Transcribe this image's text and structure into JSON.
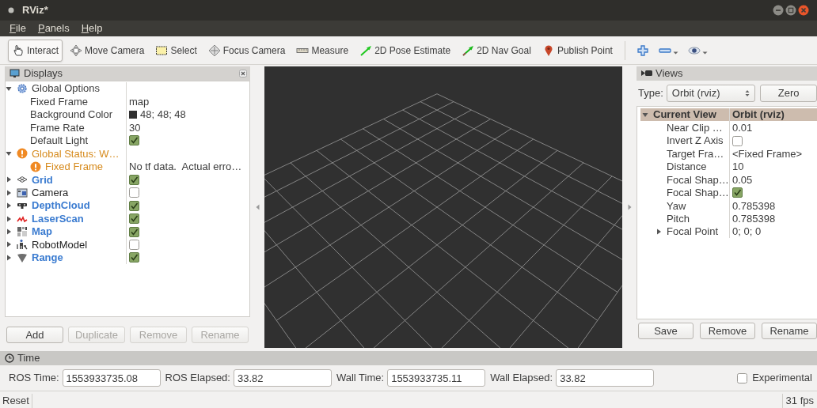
{
  "window": {
    "title": "RViz*"
  },
  "menu": [
    {
      "label": "File"
    },
    {
      "label": "Panels"
    },
    {
      "label": "Help"
    }
  ],
  "toolbar": {
    "tools": [
      {
        "label": "Interact",
        "selected": true
      },
      {
        "label": "Move Camera",
        "selected": false
      },
      {
        "label": "Select",
        "selected": false
      },
      {
        "label": "Focus Camera",
        "selected": false
      },
      {
        "label": "Measure",
        "selected": false
      },
      {
        "label": "2D Pose Estimate",
        "selected": false
      },
      {
        "label": "2D Nav Goal",
        "selected": false
      },
      {
        "label": "Publish Point",
        "selected": false
      }
    ]
  },
  "displays_panel": {
    "title": "Displays",
    "tree": [
      {
        "label": "Global Options",
        "expanded": true,
        "children": [
          {
            "label": "Fixed Frame",
            "value": "map"
          },
          {
            "label": "Background Color",
            "value": "48; 48; 48",
            "color": "#303030"
          },
          {
            "label": "Frame Rate",
            "value": "30"
          },
          {
            "label": "Default Light",
            "checked": true
          }
        ]
      },
      {
        "label": "Global Status: W…",
        "warning": true,
        "expanded": true,
        "children": [
          {
            "label": "Fixed Frame",
            "warning": true,
            "value": "No tf data.  Actual erro…"
          }
        ]
      },
      {
        "label": "Grid",
        "checked": true,
        "expanded": false
      },
      {
        "label": "Camera",
        "checked": false,
        "expanded": false
      },
      {
        "label": "DepthCloud",
        "checked": true,
        "expanded": false
      },
      {
        "label": "LaserScan",
        "checked": true,
        "expanded": false
      },
      {
        "label": "Map",
        "checked": true,
        "expanded": false
      },
      {
        "label": "RobotModel",
        "checked": false,
        "expanded": false
      },
      {
        "label": "Range",
        "checked": true,
        "expanded": false
      }
    ],
    "buttons": [
      {
        "label": "Add",
        "disabled": false
      },
      {
        "label": "Duplicate",
        "disabled": true
      },
      {
        "label": "Remove",
        "disabled": true
      },
      {
        "label": "Rename",
        "disabled": true
      }
    ]
  },
  "views_panel": {
    "title": "Views",
    "type_label": "Type:",
    "type_value": "Orbit (rviz)",
    "zero_button": "Zero",
    "tree": [
      {
        "label": "Current View",
        "value": "Orbit (rviz)",
        "expanded": true,
        "children": [
          {
            "label": "Near Clip …",
            "value": "0.01"
          },
          {
            "label": "Invert Z Axis",
            "checked": false
          },
          {
            "label": "Target Fra…",
            "value": "<Fixed Frame>"
          },
          {
            "label": "Distance",
            "value": "10"
          },
          {
            "label": "Focal Shap…",
            "value": "0.05"
          },
          {
            "label": "Focal Shap…",
            "checked": true
          },
          {
            "label": "Yaw",
            "value": "0.785398"
          },
          {
            "label": "Pitch",
            "value": "0.785398"
          },
          {
            "label": "Focal Point",
            "value": "0; 0; 0",
            "expanded": false
          }
        ]
      }
    ],
    "buttons": [
      {
        "label": "Save"
      },
      {
        "label": "Remove"
      },
      {
        "label": "Rename"
      }
    ]
  },
  "time_panel": {
    "title": "Time",
    "fields": [
      {
        "label": "ROS Time:",
        "value": "1553933735.08"
      },
      {
        "label": "ROS Elapsed:",
        "value": "33.82"
      },
      {
        "label": "Wall Time:",
        "value": "1553933735.11"
      },
      {
        "label": "Wall Elapsed:",
        "value": "33.82"
      }
    ],
    "experimental": {
      "label": "Experimental",
      "checked": false
    }
  },
  "status_bar": {
    "reset_button": "Reset",
    "fps": "31 fps"
  }
}
